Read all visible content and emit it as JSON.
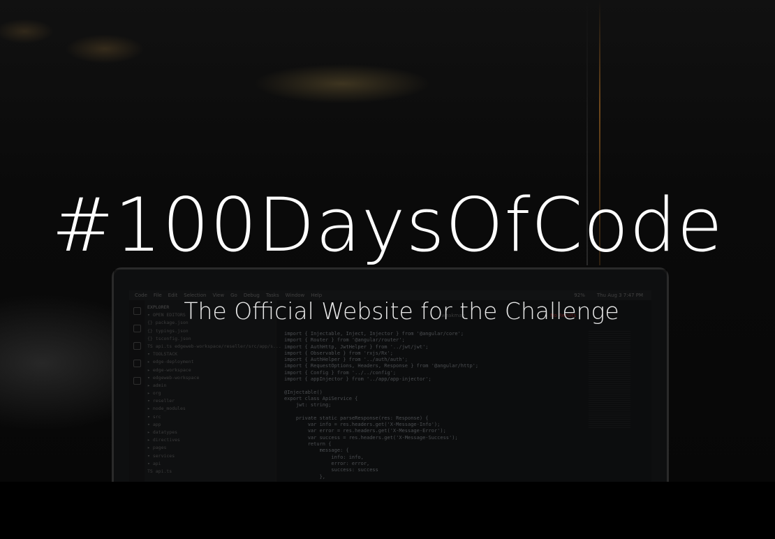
{
  "hero": {
    "title": "#100DaysOfCode",
    "subtitle": "The Official Website for the Challenge"
  },
  "background_editor": {
    "menubar": [
      "Code",
      "File",
      "Edit",
      "Selection",
      "View",
      "Go",
      "Debug",
      "Tasks",
      "Window",
      "Help"
    ],
    "clock": "Thu Aug 3  7:47 PM",
    "battery": "92%",
    "explorer_title": "EXPLORER",
    "tree": [
      "▾ OPEN EDITORS",
      "   {} package.json",
      "   {} typings.json",
      "   {} tsconfig.json",
      "   TS api.ts  edgeweb-workspace/reseller/src/app/s...",
      "▾ TOOLSTACK",
      "  ▸ edge-deployment",
      "  ▸ edge-workspace",
      "  ▾ edgeweb-workspace",
      "    ▸ admin",
      "    ▸ org",
      "    ▾ reseller",
      "      ▸ node_modules",
      "      ▾ src",
      "        ▾ app",
      "          ▸ datatypes",
      "          ▸ directives",
      "          ▸ pages",
      "          ▾ services",
      "            ▾ api",
      "              TS api.ts"
    ],
    "search_label": "weakmap",
    "search_result": "No Results",
    "code_lines": [
      "import { Injectable, Inject, Injector } from '@angular/core';",
      "import { Router } from '@angular/router';",
      "import { AuthHttp, JwtHelper } from '../jwt/jwt';",
      "import { Observable } from 'rxjs/Rx';",
      "import { AuthHelper } from '../auth/auth';",
      "import { RequestOptions, Headers, Response } from '@angular/http';",
      "import { Config } from '../../config';",
      "import { appInjector } from '../app/app-injector';",
      "",
      "@Injectable()",
      "export class ApiService {",
      "    jwt: string;",
      "",
      "    private static parseResponse(res: Response) {",
      "        var info = res.headers.get('X-Message-Info');",
      "        var error = res.headers.get('X-Message-Error');",
      "        var success = res.headers.get('X-Message-Success');",
      "        return {",
      "            message: {",
      "                info: info,",
      "                error: error,",
      "                success: success",
      "            },"
    ]
  },
  "colors": {
    "background": "#000000",
    "title_text": "#ffffff",
    "accent_light": "#be7828"
  }
}
